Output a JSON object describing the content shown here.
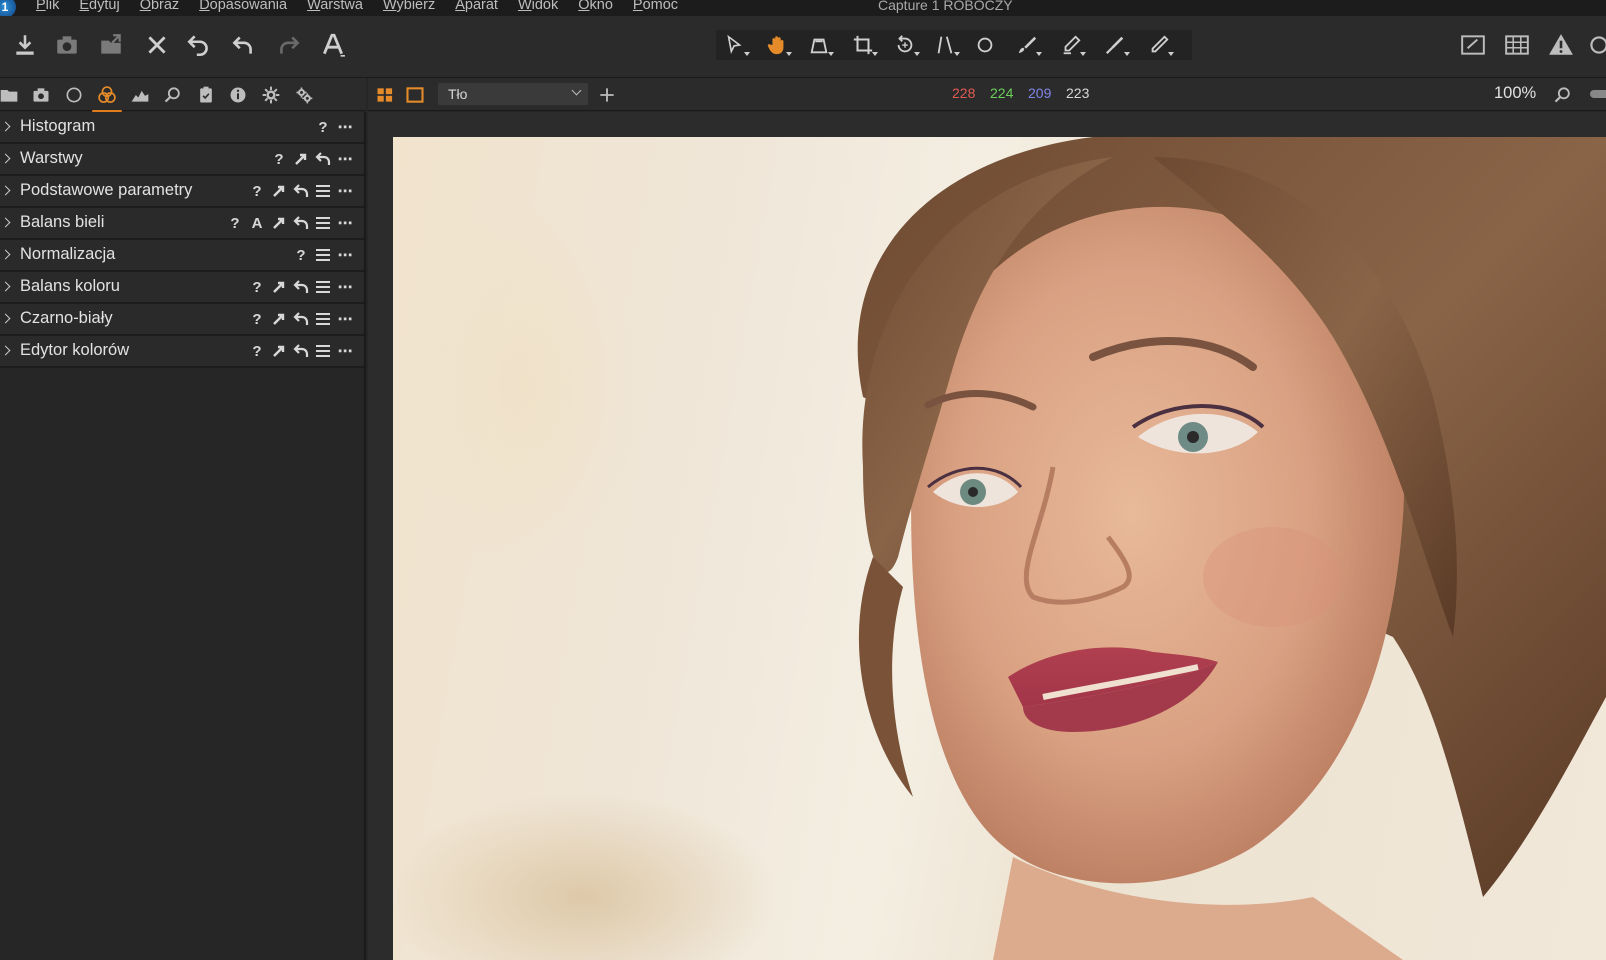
{
  "app": {
    "logo_text": "1",
    "window_title": "Capture 1 ROBOCZY"
  },
  "menu": [
    "Plik",
    "Edytuj",
    "Obraz",
    "Dopasowania",
    "Warstwa",
    "Wybierz",
    "Aparat",
    "Widok",
    "Okno",
    "Pomoc"
  ],
  "toolbar": {
    "left_icons": [
      "import-icon",
      "camera-icon",
      "export-icon",
      "delete-icon",
      "undo-icon",
      "undo-icon",
      "redo-icon",
      "text-icon"
    ],
    "cursor_tools": [
      "select-icon",
      "pan-hand-icon",
      "loupe-icon",
      "crop-icon",
      "rotate-icon",
      "keystone-icon",
      "spot-removal-icon",
      "brush-icon",
      "eraser-icon",
      "gradient-icon",
      "linear-mask-icon"
    ],
    "right_icons": [
      "proof-icon",
      "grid-icon",
      "exposure-warning-icon",
      "overlay-icon"
    ],
    "accent_color": "#e58b2a"
  },
  "tool_tabs": {
    "icons": [
      "library-icon",
      "capture-icon",
      "lens-icon",
      "color-icon",
      "exposure-icon",
      "details-icon",
      "adjustments-icon",
      "metadata-icon",
      "output-icon",
      "batch-icon"
    ],
    "active_index": 3
  },
  "viewer": {
    "layer_select_value": "Tło",
    "readout": {
      "r": "228",
      "g": "224",
      "b": "209",
      "l": "223"
    },
    "readout_colors": {
      "r": "#e05a52",
      "g": "#6bcf5a",
      "b": "#7f86e8",
      "l": "#d8d8d8"
    },
    "zoom": "100%"
  },
  "tools": [
    {
      "name": "Histogram",
      "icons": [
        "?",
        "more"
      ]
    },
    {
      "name": "Warstwy",
      "icons": [
        "?",
        "copy",
        "reset",
        "more"
      ]
    },
    {
      "name": "Podstawowe parametry",
      "icons": [
        "?",
        "copy",
        "reset",
        "presets",
        "more"
      ]
    },
    {
      "name": "Balans bieli",
      "icons": [
        "?",
        "A",
        "copy",
        "reset",
        "presets",
        "more"
      ]
    },
    {
      "name": "Normalizacja",
      "icons": [
        "?",
        "presets",
        "more"
      ]
    },
    {
      "name": "Balans koloru",
      "icons": [
        "?",
        "copy",
        "reset",
        "presets",
        "more"
      ]
    },
    {
      "name": "Czarno-biały",
      "icons": [
        "?",
        "copy",
        "reset",
        "presets",
        "more"
      ]
    },
    {
      "name": "Edytor kolorów",
      "icons": [
        "?",
        "copy",
        "reset",
        "presets",
        "more"
      ]
    }
  ]
}
